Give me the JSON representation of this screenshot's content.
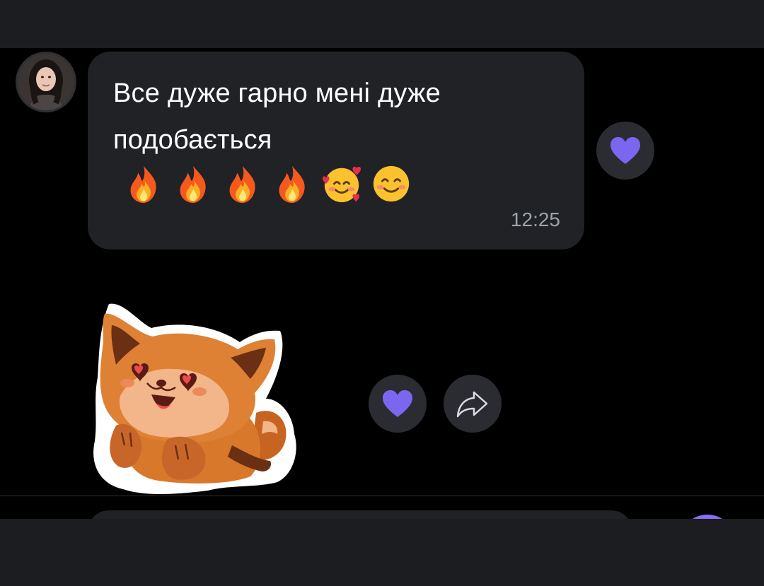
{
  "messages": [
    {
      "text": "Все дуже гарно мені дуже подобається",
      "emojis": [
        "fire-emoji",
        "fire-emoji",
        "fire-emoji",
        "fire-emoji",
        "smiling-face-with-hearts-emoji",
        "smiling-face-emoji"
      ],
      "time": "12:25",
      "reaction_icon": "heart-icon"
    },
    {
      "type": "sticker",
      "sticker_icon": "red-panda-sticker",
      "reaction_icon": "heart-icon",
      "share_icon": "share-icon"
    }
  ],
  "colors": {
    "accent": "#7b66f0",
    "bubble": "#202226",
    "bar": "#1b1d21",
    "timestamp": "#9ea3ab"
  }
}
